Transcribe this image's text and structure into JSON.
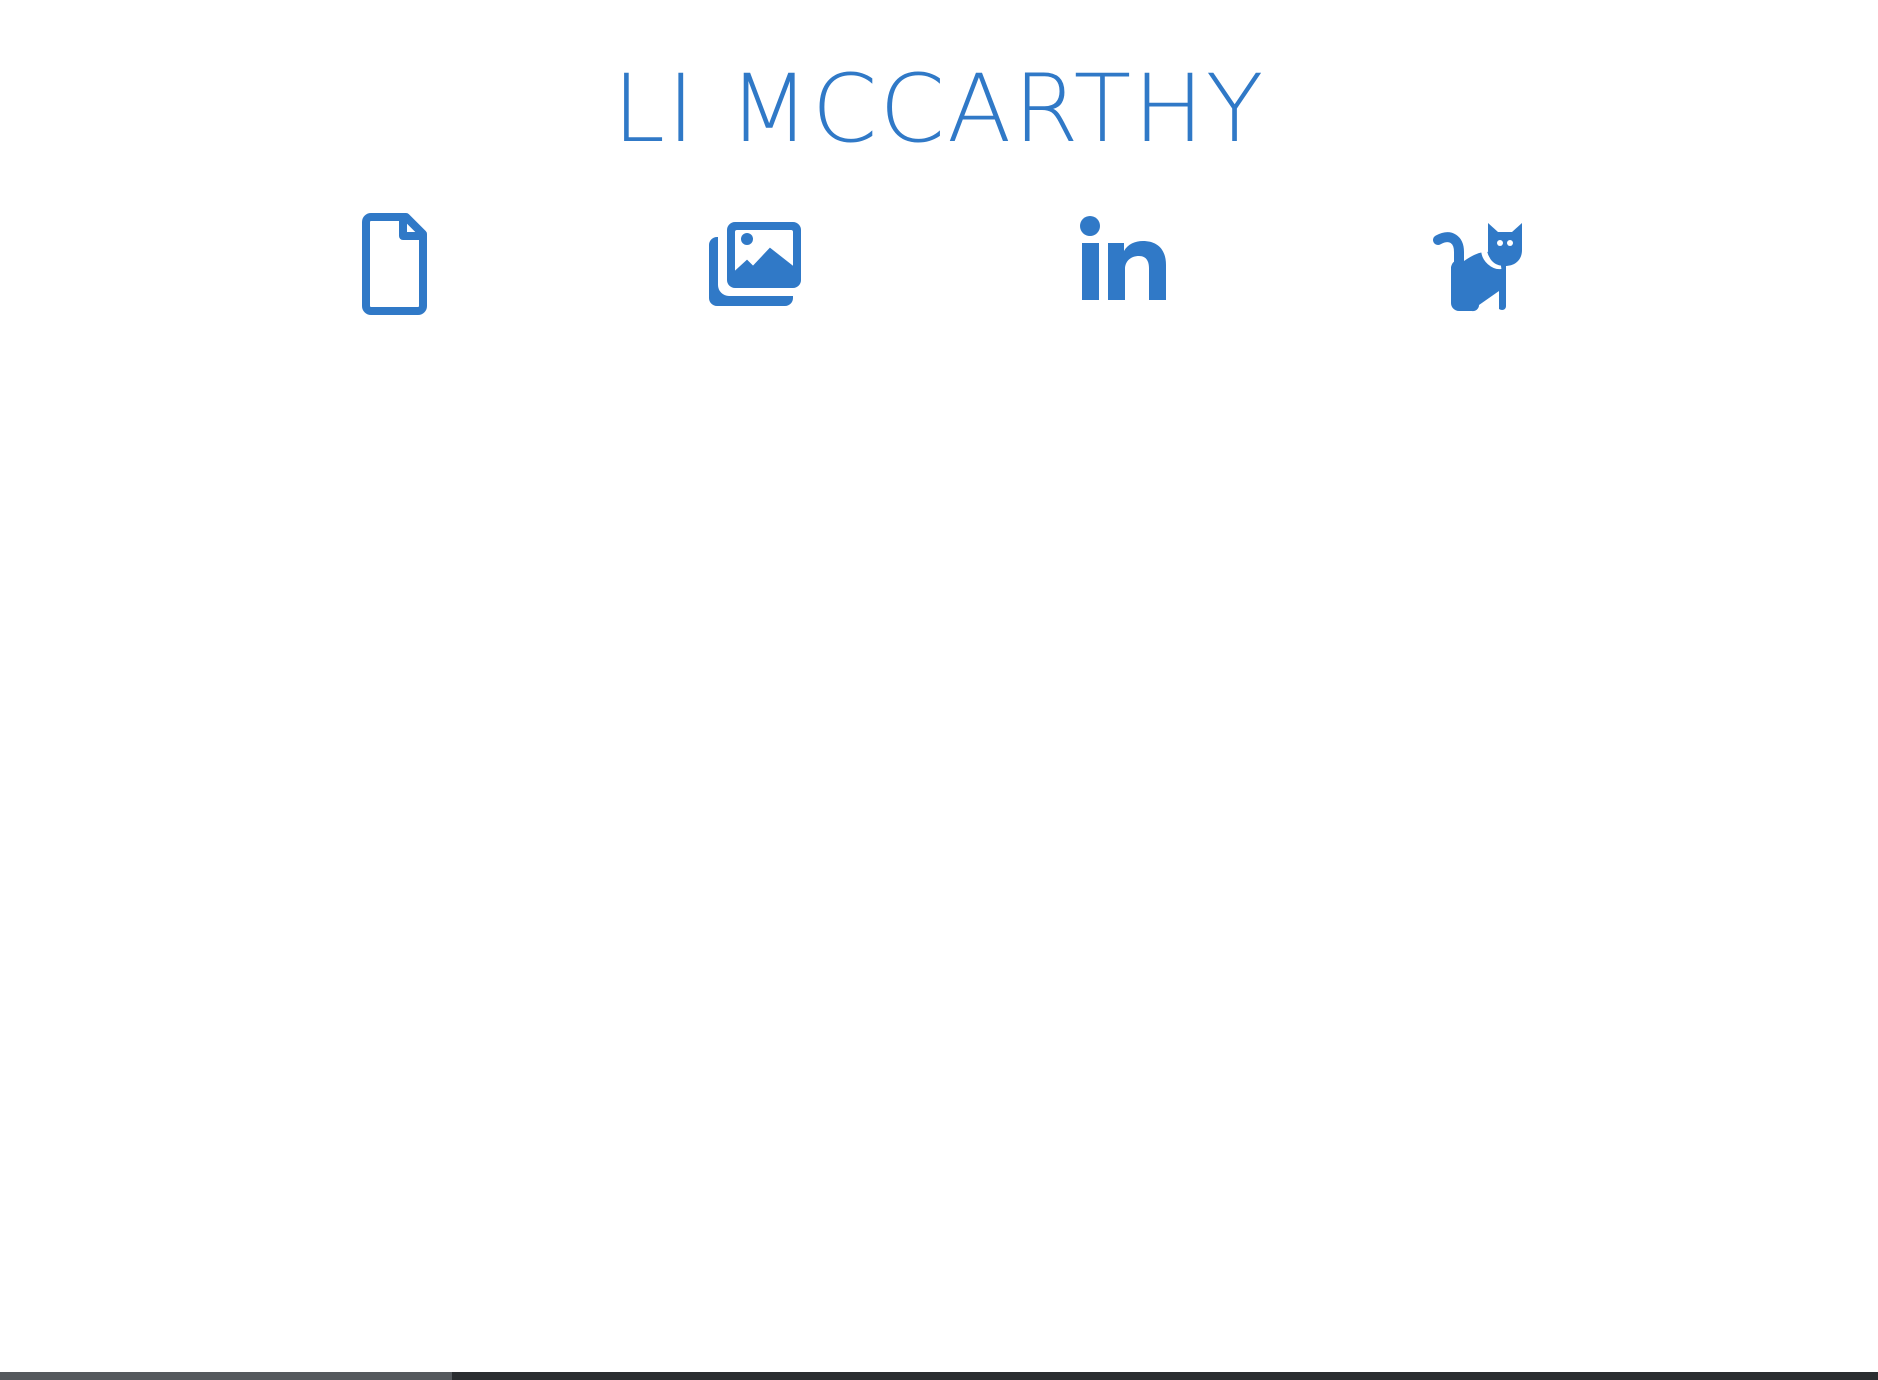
{
  "header": {
    "title": "LI MCCARTHY"
  },
  "theme": {
    "accent": "#3079c7",
    "background": "#ffffff"
  },
  "nav": {
    "links": [
      {
        "icon": "document-icon"
      },
      {
        "icon": "image-gallery-icon"
      },
      {
        "icon": "linkedin-icon"
      },
      {
        "icon": "cat-icon"
      }
    ]
  },
  "scrollbar": {
    "position": 0.24
  }
}
